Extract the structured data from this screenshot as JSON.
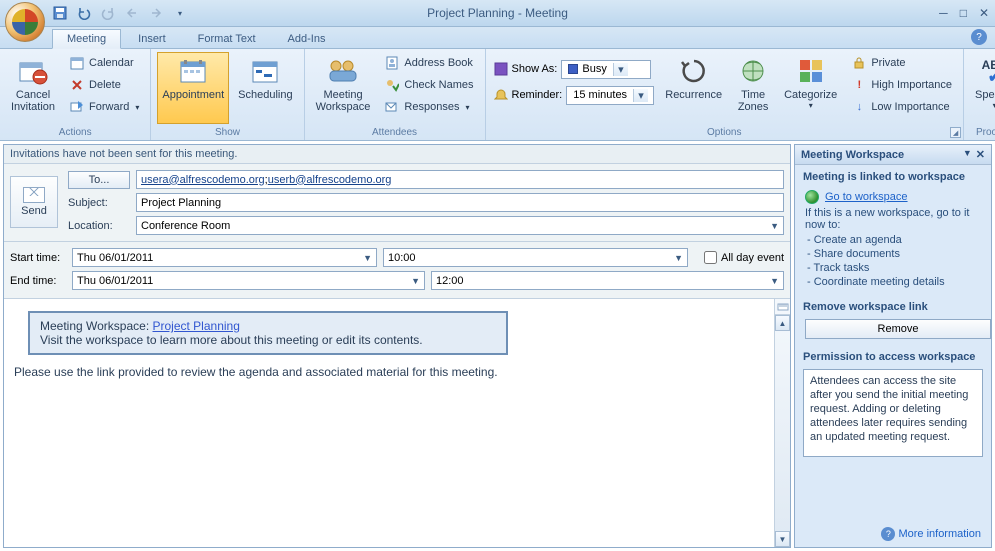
{
  "window": {
    "title": "Project Planning - Meeting"
  },
  "tabs": {
    "meeting": "Meeting",
    "insert": "Insert",
    "format": "Format Text",
    "addins": "Add-Ins"
  },
  "ribbon": {
    "actions": {
      "label": "Actions",
      "cancel": "Cancel\nInvitation",
      "calendar": "Calendar",
      "delete": "Delete",
      "forward": "Forward"
    },
    "show": {
      "label": "Show",
      "appointment": "Appointment",
      "scheduling": "Scheduling"
    },
    "attendees": {
      "label": "Attendees",
      "workspace": "Meeting\nWorkspace",
      "addressbook": "Address Book",
      "checknames": "Check Names",
      "responses": "Responses"
    },
    "options": {
      "label": "Options",
      "showas_lbl": "Show As:",
      "showas_val": "Busy",
      "reminder_lbl": "Reminder:",
      "reminder_val": "15 minutes",
      "recurrence": "Recurrence",
      "timezones": "Time\nZones",
      "categorize": "Categorize",
      "private": "Private",
      "highimp": "High Importance",
      "lowimp": "Low Importance"
    },
    "proofing": {
      "label": "Proofing",
      "spelling": "Spelling"
    }
  },
  "infobar": "Invitations have not been sent for this meeting.",
  "form": {
    "send": "Send",
    "to_button": "To...",
    "to_a": "usera@alfrescodemo.org",
    "to_sep": "; ",
    "to_b": "userb@alfrescodemo.org",
    "subject_lbl": "Subject:",
    "subject_val": "Project Planning",
    "location_lbl": "Location:",
    "location_val": "Conference Room",
    "start_lbl": "Start time:",
    "start_date": "Thu 06/01/2011",
    "start_time": "10:00",
    "end_lbl": "End time:",
    "end_date": "Thu 06/01/2011",
    "end_time": "12:00",
    "allday": "All day event"
  },
  "body": {
    "ws_prefix": "Meeting Workspace: ",
    "ws_link": "Project Planning",
    "ws_hint": "Visit the workspace to learn more about this meeting or edit its contents.",
    "text": "Please use the link provided to review the agenda and associated material for this meeting."
  },
  "pane": {
    "title": "Meeting Workspace",
    "linked_h": "Meeting is linked to workspace",
    "goto": "Go to workspace",
    "ifnew": "If this is a new workspace, go to it now to:",
    "b1": "Create an agenda",
    "b2": "Share documents",
    "b3": "Track tasks",
    "b4": "Coordinate meeting details",
    "remove_h": "Remove workspace link",
    "remove_btn": "Remove",
    "perm_h": "Permission to access workspace",
    "perm_txt": "Attendees can access the site after you send the initial meeting request. Adding or deleting attendees later requires sending an updated meeting request.",
    "more": "More information"
  }
}
